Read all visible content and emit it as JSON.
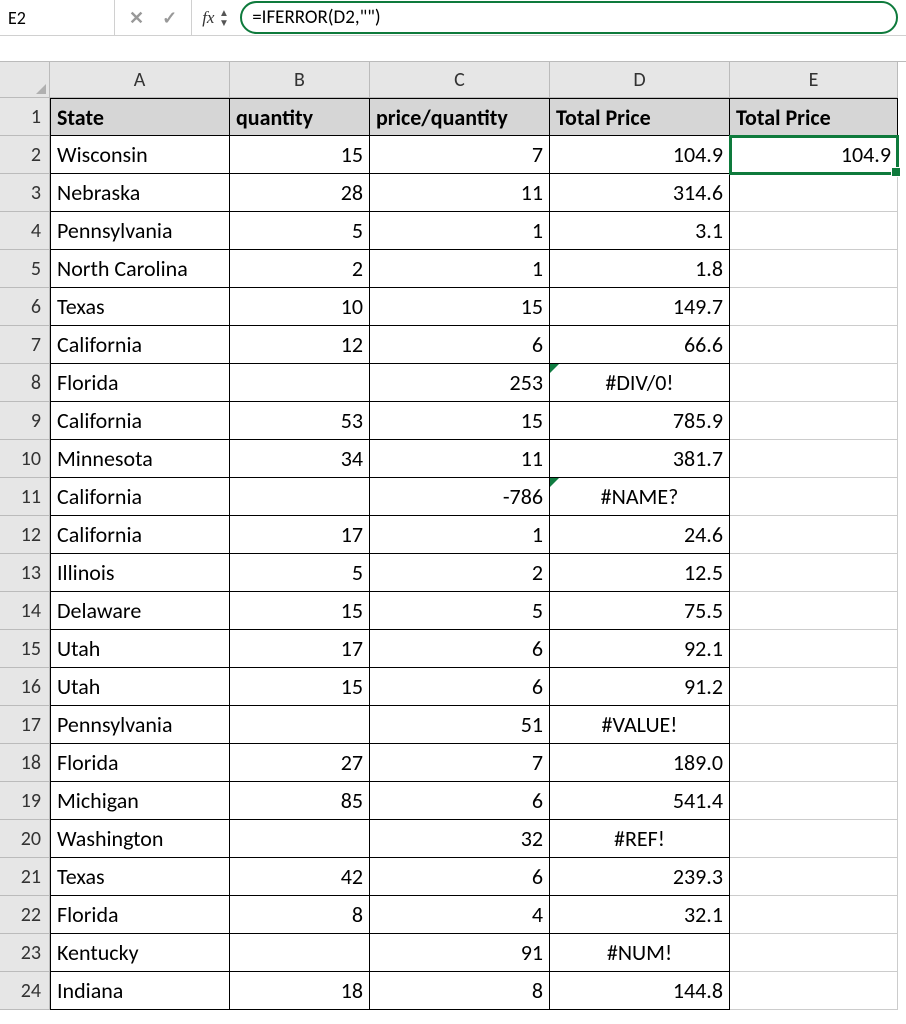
{
  "name_box": {
    "value": "E2"
  },
  "formula_bar": {
    "fx_label": "fx",
    "cancel_glyph": "✕",
    "confirm_glyph": "✓",
    "formula": "=IFERROR(D2,\"\")"
  },
  "columns": [
    "A",
    "B",
    "C",
    "D",
    "E"
  ],
  "row_headers": [
    "1",
    "2",
    "3",
    "4",
    "5",
    "6",
    "7",
    "8",
    "9",
    "10",
    "11",
    "12",
    "13",
    "14",
    "15",
    "16",
    "17",
    "18",
    "19",
    "20",
    "21",
    "22",
    "23",
    "24"
  ],
  "headers": {
    "A": "State",
    "B": "quantity",
    "C": "price/quantity",
    "D": "Total Price",
    "E": "Total Price"
  },
  "rows": [
    {
      "A": "Wisconsin",
      "B": "15",
      "C": "7",
      "D": "104.9",
      "E": "104.9",
      "err": false
    },
    {
      "A": "Nebraska",
      "B": "28",
      "C": "11",
      "D": "314.6",
      "E": "",
      "err": false
    },
    {
      "A": "Pennsylvania",
      "B": "5",
      "C": "1",
      "D": "3.1",
      "E": "",
      "err": false
    },
    {
      "A": "North Carolina",
      "B": "2",
      "C": "1",
      "D": "1.8",
      "E": "",
      "err": false
    },
    {
      "A": "Texas",
      "B": "10",
      "C": "15",
      "D": "149.7",
      "E": "",
      "err": false
    },
    {
      "A": "California",
      "B": "12",
      "C": "6",
      "D": "66.6",
      "E": "",
      "err": false
    },
    {
      "A": "Florida",
      "B": "",
      "C": "253",
      "D": "#DIV/0!",
      "E": "",
      "err": true
    },
    {
      "A": "California",
      "B": "53",
      "C": "15",
      "D": "785.9",
      "E": "",
      "err": false
    },
    {
      "A": "Minnesota",
      "B": "34",
      "C": "11",
      "D": "381.7",
      "E": "",
      "err": false
    },
    {
      "A": "California",
      "B": "",
      "C": "-786",
      "D": "#NAME?",
      "E": "",
      "err": true
    },
    {
      "A": "California",
      "B": "17",
      "C": "1",
      "D": "24.6",
      "E": "",
      "err": false
    },
    {
      "A": "Illinois",
      "B": "5",
      "C": "2",
      "D": "12.5",
      "E": "",
      "err": false
    },
    {
      "A": "Delaware",
      "B": "15",
      "C": "5",
      "D": "75.5",
      "E": "",
      "err": false
    },
    {
      "A": "Utah",
      "B": "17",
      "C": "6",
      "D": "92.1",
      "E": "",
      "err": false
    },
    {
      "A": "Utah",
      "B": "15",
      "C": "6",
      "D": "91.2",
      "E": "",
      "err": false
    },
    {
      "A": "Pennsylvania",
      "B": "",
      "C": "51",
      "D": "#VALUE!",
      "E": "",
      "err": false
    },
    {
      "A": "Florida",
      "B": "27",
      "C": "7",
      "D": "189.0",
      "E": "",
      "err": false
    },
    {
      "A": "Michigan",
      "B": "85",
      "C": "6",
      "D": "541.4",
      "E": "",
      "err": false
    },
    {
      "A": "Washington",
      "B": "",
      "C": "32",
      "D": "#REF!",
      "E": "",
      "err": false
    },
    {
      "A": "Texas",
      "B": "42",
      "C": "6",
      "D": "239.3",
      "E": "",
      "err": false
    },
    {
      "A": "Florida",
      "B": "8",
      "C": "4",
      "D": "32.1",
      "E": "",
      "err": false
    },
    {
      "A": "Kentucky",
      "B": "",
      "C": "91",
      "D": "#NUM!",
      "E": "",
      "err": false
    },
    {
      "A": "Indiana",
      "B": "18",
      "C": "8",
      "D": "144.8",
      "E": "",
      "err": false
    }
  ],
  "selected_cell": "E2",
  "chart_data": {
    "type": "table",
    "title": "",
    "columns": [
      "State",
      "quantity",
      "price/quantity",
      "Total Price",
      "Total Price"
    ],
    "data": [
      [
        "Wisconsin",
        15,
        7,
        104.9,
        104.9
      ],
      [
        "Nebraska",
        28,
        11,
        314.6,
        null
      ],
      [
        "Pennsylvania",
        5,
        1,
        3.1,
        null
      ],
      [
        "North Carolina",
        2,
        1,
        1.8,
        null
      ],
      [
        "Texas",
        10,
        15,
        149.7,
        null
      ],
      [
        "California",
        12,
        6,
        66.6,
        null
      ],
      [
        "Florida",
        null,
        253,
        "#DIV/0!",
        null
      ],
      [
        "California",
        53,
        15,
        785.9,
        null
      ],
      [
        "Minnesota",
        34,
        11,
        381.7,
        null
      ],
      [
        "California",
        null,
        -786,
        "#NAME?",
        null
      ],
      [
        "California",
        17,
        1,
        24.6,
        null
      ],
      [
        "Illinois",
        5,
        2,
        12.5,
        null
      ],
      [
        "Delaware",
        15,
        5,
        75.5,
        null
      ],
      [
        "Utah",
        17,
        6,
        92.1,
        null
      ],
      [
        "Utah",
        15,
        6,
        91.2,
        null
      ],
      [
        "Pennsylvania",
        null,
        51,
        "#VALUE!",
        null
      ],
      [
        "Florida",
        27,
        7,
        189.0,
        null
      ],
      [
        "Michigan",
        85,
        6,
        541.4,
        null
      ],
      [
        "Washington",
        null,
        32,
        "#REF!",
        null
      ],
      [
        "Texas",
        42,
        6,
        239.3,
        null
      ],
      [
        "Florida",
        8,
        4,
        32.1,
        null
      ],
      [
        "Kentucky",
        null,
        91,
        "#NUM!",
        null
      ],
      [
        "Indiana",
        18,
        8,
        144.8,
        null
      ]
    ]
  }
}
